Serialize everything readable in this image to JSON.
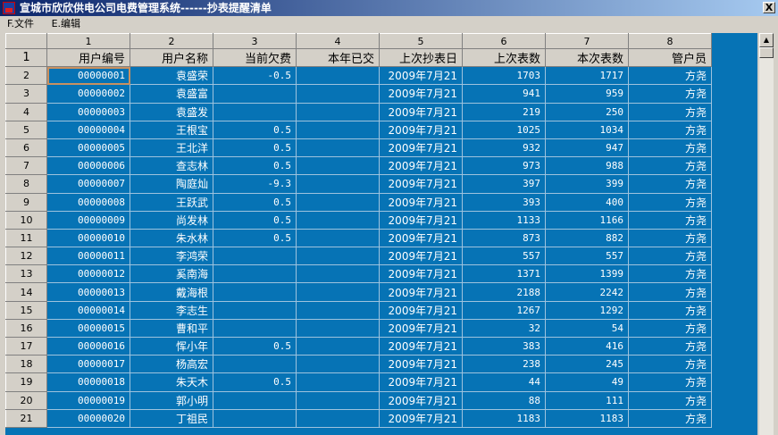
{
  "window": {
    "title": "宣城市欣欣供电公司电费管理系统------抄表提醒清单",
    "close": "X"
  },
  "menu": [
    {
      "label": "F.文件"
    },
    {
      "label": "E.编辑"
    }
  ],
  "column_numbers": [
    "1",
    "2",
    "3",
    "4",
    "5",
    "6",
    "7",
    "8"
  ],
  "headers": [
    "用户编号",
    "用户名称",
    "当前欠费",
    "本年已交",
    "上次抄表日",
    "上次表数",
    "本次表数",
    "管户员"
  ],
  "header_row_number": "1",
  "rows": [
    [
      "2",
      "00000001",
      "袁盛荣",
      "-0.5",
      "",
      "2009年7月21",
      "1703",
      "1717",
      "方尧"
    ],
    [
      "3",
      "00000002",
      "袁盛富",
      "",
      "",
      "2009年7月21",
      "941",
      "959",
      "方尧"
    ],
    [
      "4",
      "00000003",
      "袁盛发",
      "",
      "",
      "2009年7月21",
      "219",
      "250",
      "方尧"
    ],
    [
      "5",
      "00000004",
      "王根宝",
      "0.5",
      "",
      "2009年7月21",
      "1025",
      "1034",
      "方尧"
    ],
    [
      "6",
      "00000005",
      "王北洋",
      "0.5",
      "",
      "2009年7月21",
      "932",
      "947",
      "方尧"
    ],
    [
      "7",
      "00000006",
      "查志林",
      "0.5",
      "",
      "2009年7月21",
      "973",
      "988",
      "方尧"
    ],
    [
      "8",
      "00000007",
      "陶庭灿",
      "-9.3",
      "",
      "2009年7月21",
      "397",
      "399",
      "方尧"
    ],
    [
      "9",
      "00000008",
      "王跃武",
      "0.5",
      "",
      "2009年7月21",
      "393",
      "400",
      "方尧"
    ],
    [
      "10",
      "00000009",
      "尚发林",
      "0.5",
      "",
      "2009年7月21",
      "1133",
      "1166",
      "方尧"
    ],
    [
      "11",
      "00000010",
      "朱水林",
      "0.5",
      "",
      "2009年7月21",
      "873",
      "882",
      "方尧"
    ],
    [
      "12",
      "00000011",
      "李鸿荣",
      "",
      "",
      "2009年7月21",
      "557",
      "557",
      "方尧"
    ],
    [
      "13",
      "00000012",
      "奚南海",
      "",
      "",
      "2009年7月21",
      "1371",
      "1399",
      "方尧"
    ],
    [
      "14",
      "00000013",
      "戴海根",
      "",
      "",
      "2009年7月21",
      "2188",
      "2242",
      "方尧"
    ],
    [
      "15",
      "00000014",
      "李志生",
      "",
      "",
      "2009年7月21",
      "1267",
      "1292",
      "方尧"
    ],
    [
      "16",
      "00000015",
      "曹和平",
      "",
      "",
      "2009年7月21",
      "32",
      "54",
      "方尧"
    ],
    [
      "17",
      "00000016",
      "恽小年",
      "0.5",
      "",
      "2009年7月21",
      "383",
      "416",
      "方尧"
    ],
    [
      "18",
      "00000017",
      "杨高宏",
      "",
      "",
      "2009年7月21",
      "238",
      "245",
      "方尧"
    ],
    [
      "19",
      "00000018",
      "朱天木",
      "0.5",
      "",
      "2009年7月21",
      "44",
      "49",
      "方尧"
    ],
    [
      "20",
      "00000019",
      "郭小明",
      "",
      "",
      "2009年7月21",
      "88",
      "111",
      "方尧"
    ],
    [
      "21",
      "00000020",
      "丁祖民",
      "",
      "",
      "2009年7月21",
      "1183",
      "1183",
      "方尧"
    ]
  ]
}
